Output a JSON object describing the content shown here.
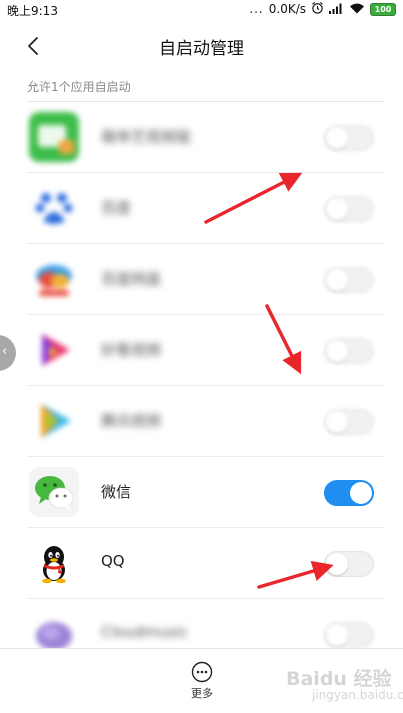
{
  "status_bar": {
    "time": "晚上9:13",
    "dots": "...",
    "network_speed": "0.0K/s",
    "battery": "100"
  },
  "header": {
    "title": "自启动管理",
    "back_icon": "chevron-left-icon"
  },
  "section": {
    "label": "允许1个应用自启动"
  },
  "apps": [
    {
      "name": "薇帝艺视频版",
      "icon": "green-video-app-icon",
      "blurred": true,
      "autostart": false
    },
    {
      "name": "百度",
      "icon": "baidu-paw-icon",
      "blurred": true,
      "autostart": false
    },
    {
      "name": "百度网盘",
      "icon": "baidu-netdisk-icon",
      "blurred": true,
      "autostart": false
    },
    {
      "name": "好看视频",
      "icon": "haokan-video-icon",
      "blurred": true,
      "autostart": false
    },
    {
      "name": "腾讯视频",
      "icon": "tencent-video-icon",
      "blurred": true,
      "autostart": false
    },
    {
      "name": "微信",
      "icon": "wechat-icon",
      "blurred": false,
      "autostart": true
    },
    {
      "name": "QQ",
      "icon": "qq-penguin-icon",
      "blurred": false,
      "autostart": false
    },
    {
      "name": "Cloudmusic",
      "icon": "purple-app-icon",
      "blurred": true,
      "autostart": false
    }
  ],
  "bottom_bar": {
    "more_label": "更多",
    "more_icon": "more-dots-icon"
  },
  "watermark": {
    "text": "Baidu 经验",
    "sub": "jingyan.baidu.com"
  },
  "colors": {
    "toggle_on": "#1f8ef1",
    "toggle_off": "#f1f1f1",
    "arrow": "#e8262b",
    "section_text": "#8a8a8a"
  }
}
